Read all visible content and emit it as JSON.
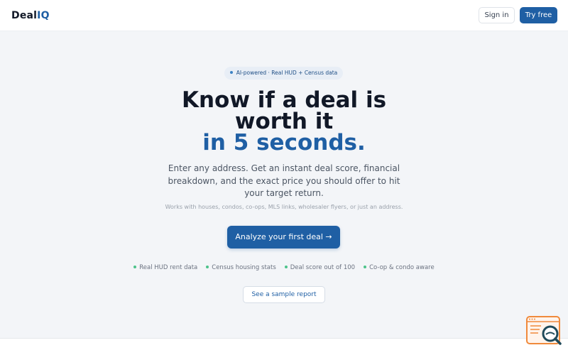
{
  "nav": {
    "brand_main": "Deal",
    "brand_accent": "IQ",
    "sign_in_label": "Sign in",
    "try_free_label": "Try free"
  },
  "hero": {
    "badge": "AI-powered · Real HUD + Census data",
    "headline_line1": "Know if a deal is worth it",
    "headline_line2": "in 5 seconds.",
    "subtitle": "Enter any address. Get an instant deal score, financial breakdown, and the exact price you should offer to hit your target return.",
    "supporting": "Works with houses, condos, co-ops, MLS links, wholesaler flyers, or just an address.",
    "cta_label": "Analyze your first deal →",
    "features": [
      "Real HUD rent data",
      "Census housing stats",
      "Deal score out of 100",
      "Co-op & condo aware"
    ],
    "sample_label": "See a sample report"
  },
  "colors": {
    "accent": "#1f5fa4",
    "feature_dot": "#4cc38a",
    "widget": "#f08a3c",
    "background": "#f3f5f8"
  },
  "icons": {
    "floating_widget": "search-document-icon"
  }
}
